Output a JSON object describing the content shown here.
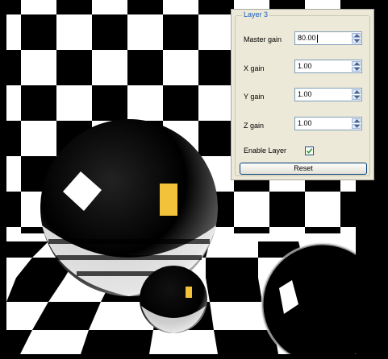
{
  "panel": {
    "title": "Layer 3",
    "fields": [
      {
        "label": "Master gain",
        "value": "80.00"
      },
      {
        "label": "X gain",
        "value": "1.00"
      },
      {
        "label": "Y gain",
        "value": "1.00"
      },
      {
        "label": "Z gain",
        "value": "1.00"
      }
    ],
    "enable_label": "Enable Layer",
    "enable_checked": true,
    "reset_label": "Reset"
  },
  "colors": {
    "panel_bg": "#ece9d8",
    "legend_text": "#1c5fbf",
    "checkmark": "#21a121",
    "scene_background": "#000000",
    "checker_light": "#ffffff",
    "checker_dark": "#000000",
    "sphere_highlight": "#f2c33a"
  },
  "scene": {
    "description_icon": "render-viewport",
    "objects": [
      "checkerboard-floor",
      "checkerboard-wall",
      "large-chrome-sphere",
      "small-chrome-sphere",
      "dark-sphere"
    ]
  }
}
